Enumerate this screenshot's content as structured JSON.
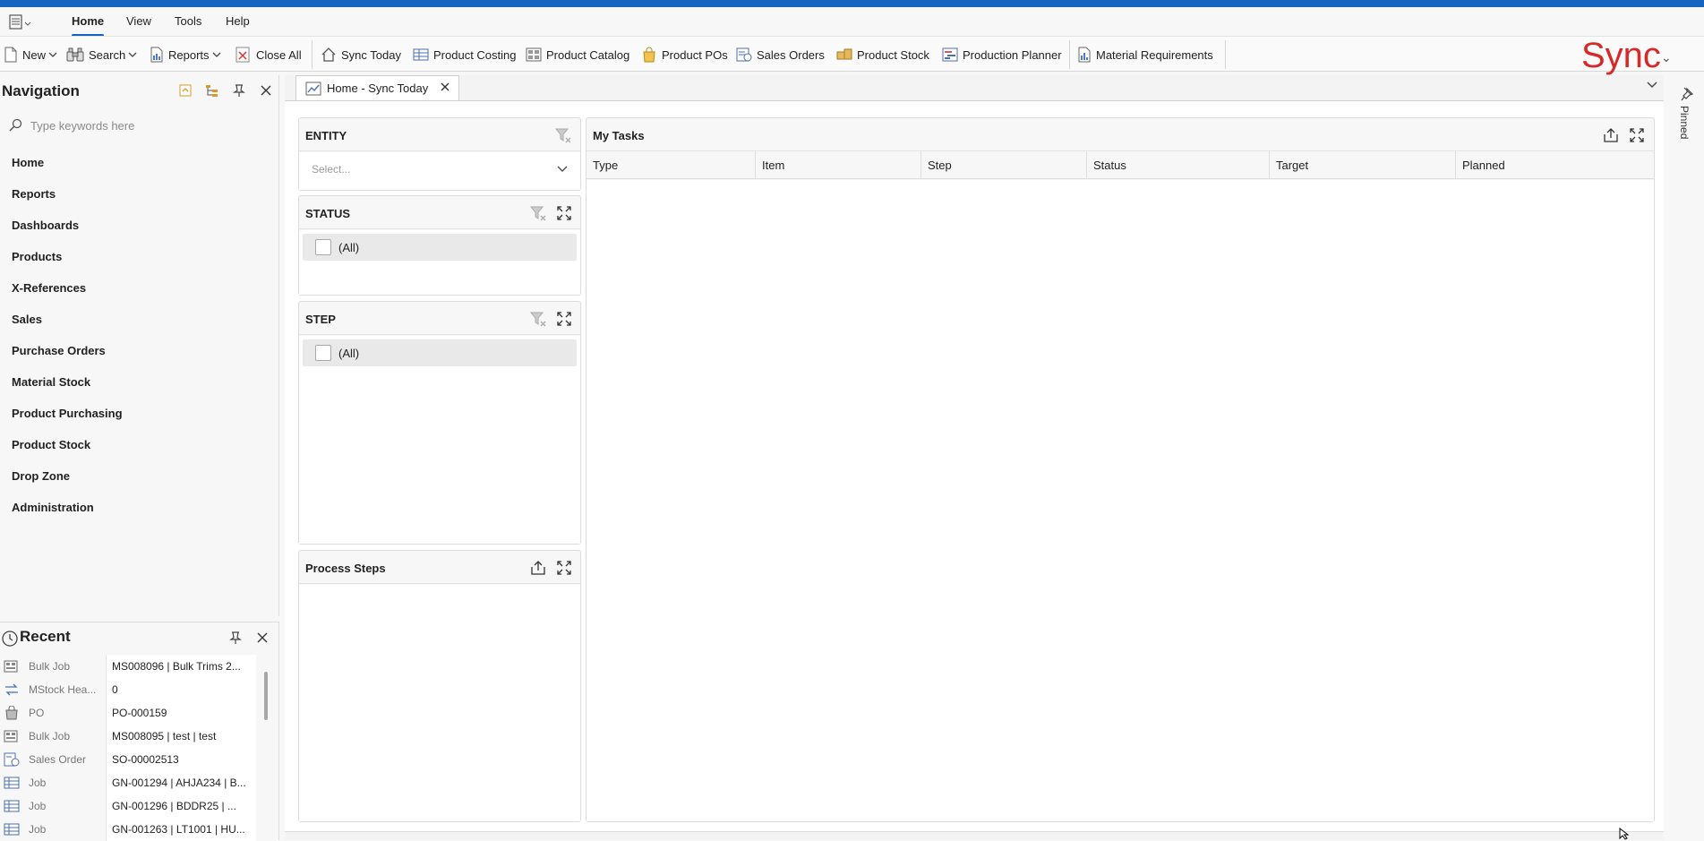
{
  "menubar": {
    "tabs": [
      {
        "label": "Home",
        "active": true
      },
      {
        "label": "View",
        "active": false
      },
      {
        "label": "Tools",
        "active": false
      },
      {
        "label": "Help",
        "active": false
      }
    ]
  },
  "ribbon": {
    "new_label": "New",
    "search_label": "Search",
    "reports_label": "Reports",
    "close_all_label": "Close All",
    "sync_today_label": "Sync Today",
    "product_costing_label": "Product Costing",
    "product_catalog_label": "Product Catalog",
    "product_pos_label": "Product POs",
    "sales_orders_label": "Sales Orders",
    "product_stock_label": "Product Stock",
    "production_planner_label": "Production Planner",
    "material_requirements_label": "Material Requirements"
  },
  "logo": {
    "text": "Sync",
    "color": "#d62a2a"
  },
  "accent_color": "#1565c0",
  "navigation": {
    "title": "Navigation",
    "search_placeholder": "Type keywords here",
    "items": [
      "Home",
      "Reports",
      "Dashboards",
      "Products",
      "X-References",
      "Sales",
      "Purchase Orders",
      "Material Stock",
      "Product Purchasing",
      "Product Stock",
      "Drop Zone",
      "Administration"
    ]
  },
  "recent": {
    "title": "Recent",
    "rows": [
      {
        "type": "Bulk Job",
        "value": "MS008096 | Bulk Trims 2...",
        "icon": "bulk-job-icon"
      },
      {
        "type": "MStock Hea...",
        "value": "0",
        "icon": "stock-transfer-icon"
      },
      {
        "type": "PO",
        "value": "PO-000159",
        "icon": "po-bag-icon"
      },
      {
        "type": "Bulk Job",
        "value": "MS008095 | test | test",
        "icon": "bulk-job-icon"
      },
      {
        "type": "Sales Order",
        "value": "SO-00002513",
        "icon": "sales-order-icon"
      },
      {
        "type": "Job",
        "value": "GN-001294 | AHJA234 | B...",
        "icon": "job-grid-icon"
      },
      {
        "type": "Job",
        "value": "GN-001296 |  BDDR25 | ...",
        "icon": "job-grid-icon"
      },
      {
        "type": "Job",
        "value": "GN-001263 | LT1001 | HU...",
        "icon": "job-grid-icon"
      }
    ]
  },
  "document": {
    "tab_label": "Home - Sync Today",
    "entity": {
      "title": "ENTITY",
      "select_placeholder": "Select..."
    },
    "status": {
      "title": "STATUS",
      "all_label": "(All)"
    },
    "step": {
      "title": "STEP",
      "all_label": "(All)"
    },
    "process_steps": {
      "title": "Process Steps"
    },
    "my_tasks": {
      "title": "My Tasks",
      "columns": [
        "Type",
        "Item",
        "Step",
        "Status",
        "Target",
        "Planned"
      ]
    },
    "pinned_label": "Pinned"
  }
}
